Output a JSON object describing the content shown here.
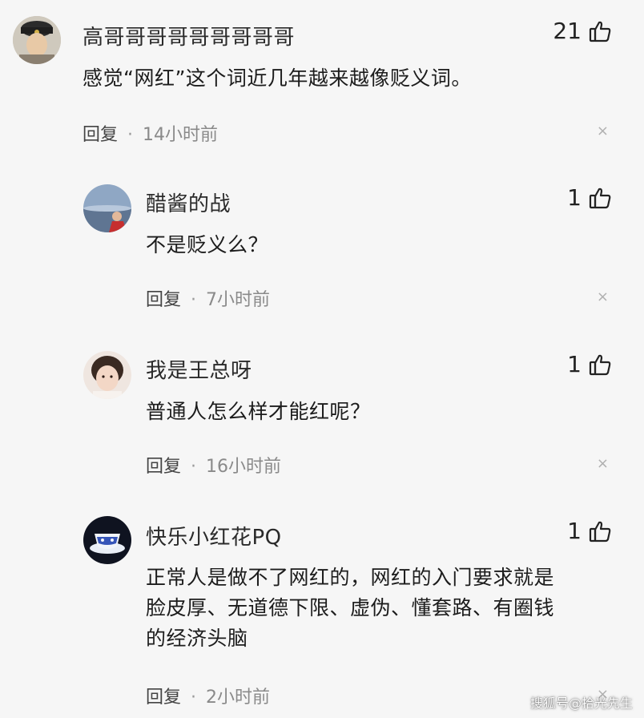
{
  "comments": [
    {
      "name": "高哥哥哥哥哥哥哥哥哥",
      "likes": "21",
      "text": "感觉“网红”这个词近几年越来越像贬义词。",
      "reply_label": "回复",
      "time": "14小时前",
      "close_symbol": "×"
    },
    {
      "name": "醋酱的战",
      "likes": "1",
      "text": "不是贬义么？",
      "reply_label": "回复",
      "time": "7小时前",
      "close_symbol": "×"
    },
    {
      "name": "我是王总呀",
      "likes": "1",
      "text": "普通人怎么样才能红呢？",
      "reply_label": "回复",
      "time": "16小时前",
      "close_symbol": "×"
    },
    {
      "name": "快乐小红花PQ",
      "likes": "1",
      "text_lines": [
        "正常人是做不了网红的，网红的入门要求就是",
        "脸皮厚、无道德下限、虚伪、懂套路、有圈钱",
        "的经济头脑"
      ],
      "reply_label": "回复",
      "time": "2小时前",
      "close_symbol": "×"
    }
  ],
  "watermark": "搜狐号@拾光先生",
  "icons": {
    "like": "thumbs-up-icon",
    "close": "close-icon"
  }
}
